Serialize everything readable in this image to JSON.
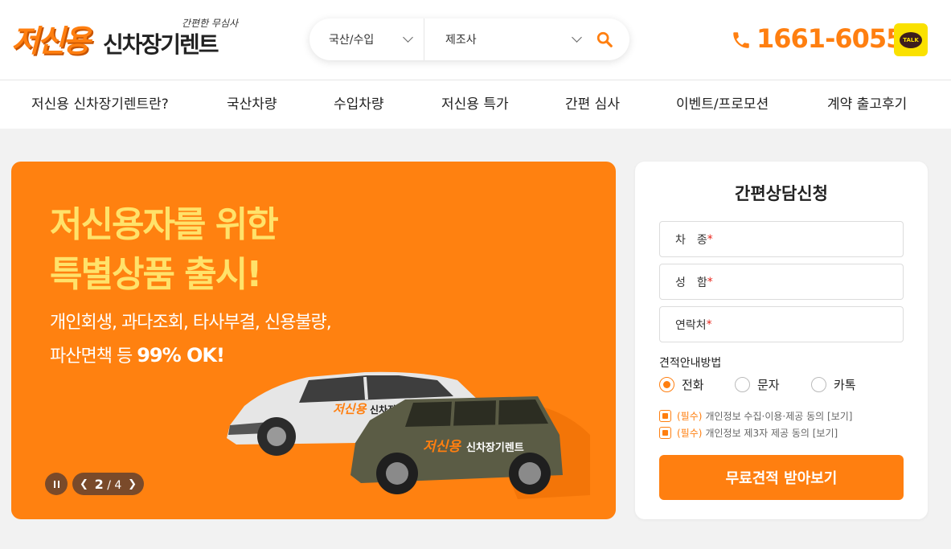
{
  "header": {
    "logo_main": "저신용",
    "logo_sub": "신차장기렌트",
    "logo_tagline": "간편한 무심사",
    "search": {
      "origin_select": "국산/수입",
      "maker_select": "제조사"
    },
    "phone": "1661-6055",
    "kakao_label": "TALK"
  },
  "nav": {
    "items": [
      {
        "label": "저신용 신차장기렌트란?"
      },
      {
        "label": "국산차량"
      },
      {
        "label": "수입차량"
      },
      {
        "label": "저신용 특가"
      },
      {
        "label": "간편 심사"
      },
      {
        "label": "이벤트/프로모션"
      },
      {
        "label": "계약 출고후기"
      }
    ]
  },
  "banner": {
    "headline_line1": "저신용자를 위한",
    "headline_line2": "특별상품 출시!",
    "sub_line1": "개인회생, 과다조회, 타사부결, 신용불량,",
    "sub_line2_prefix": "파산면책 등 ",
    "sub_line2_emphasis": "99% OK!",
    "car_logo_text": "저신용",
    "car_logo_sub": "신차장기렌트",
    "pager": {
      "current": "2",
      "separator": "/",
      "total": "4"
    },
    "background_color": "#ff8110"
  },
  "form": {
    "title": "간편상담신청",
    "fields": [
      {
        "label": "차　종",
        "required_mark": "*"
      },
      {
        "label": "성　함",
        "required_mark": "*"
      },
      {
        "label": "연락처",
        "required_mark": "*"
      }
    ],
    "guide_label": "견적안내방법",
    "methods": [
      {
        "label": "전화",
        "selected": true
      },
      {
        "label": "문자",
        "selected": false
      },
      {
        "label": "카톡",
        "selected": false
      }
    ],
    "agreements": [
      {
        "must": "(필수)",
        "text": "개인정보 수집·이용·제공 동의 [보기]"
      },
      {
        "must": "(필수)",
        "text": "개인정보 제3자 제공 동의 [보기]"
      }
    ],
    "submit_label": "무료견적 받아보기"
  },
  "colors": {
    "accent": "#ff7f10",
    "kakao": "#fae100"
  }
}
